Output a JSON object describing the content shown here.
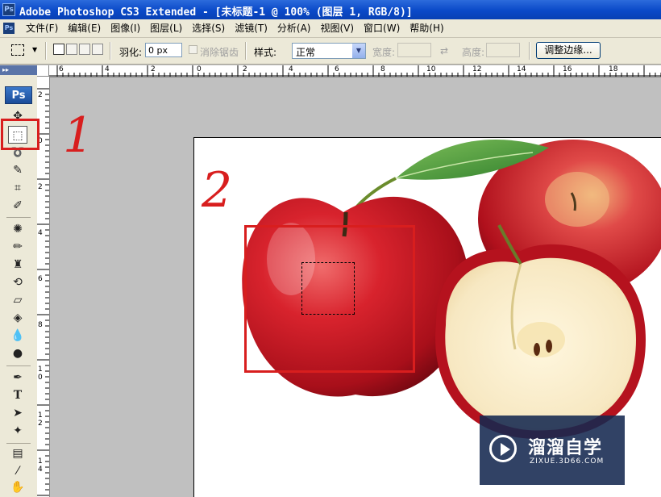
{
  "window": {
    "title": "Adobe Photoshop CS3 Extended - [未标题-1 @ 100% (图层 1, RGB/8)]",
    "logo_text": "Ps"
  },
  "menu": {
    "items": [
      "文件(F)",
      "编辑(E)",
      "图像(I)",
      "图层(L)",
      "选择(S)",
      "滤镜(T)",
      "分析(A)",
      "视图(V)",
      "窗口(W)",
      "帮助(H)"
    ]
  },
  "options": {
    "feather_label": "羽化:",
    "feather_value": "0 px",
    "antialias_label": "消除锯齿",
    "style_label": "样式:",
    "style_value": "正常",
    "width_label": "宽度:",
    "height_label": "高度:",
    "refine_edge_label": "调整边缘..."
  },
  "toolbox": {
    "logo": "Ps",
    "selected_tool": "rectangular-marquee"
  },
  "rulers": {
    "horizontal": [
      "6",
      "4",
      "2",
      "0",
      "2",
      "4",
      "6",
      "8",
      "10",
      "12",
      "14",
      "16",
      "18"
    ],
    "vertical": [
      "2",
      "0",
      "2",
      "4",
      "6",
      "8",
      "1",
      "0",
      "1",
      "2",
      "1",
      "4"
    ]
  },
  "canvas": {
    "zoom": "100%",
    "document": "未标题-1",
    "layer": "图层 1",
    "mode": "RGB/8"
  },
  "annotations": {
    "step1": "1",
    "step2": "2",
    "color": "#d81e1e"
  },
  "watermark": {
    "title": "溜溜自学",
    "url": "ZIXUE.3D66.COM"
  }
}
